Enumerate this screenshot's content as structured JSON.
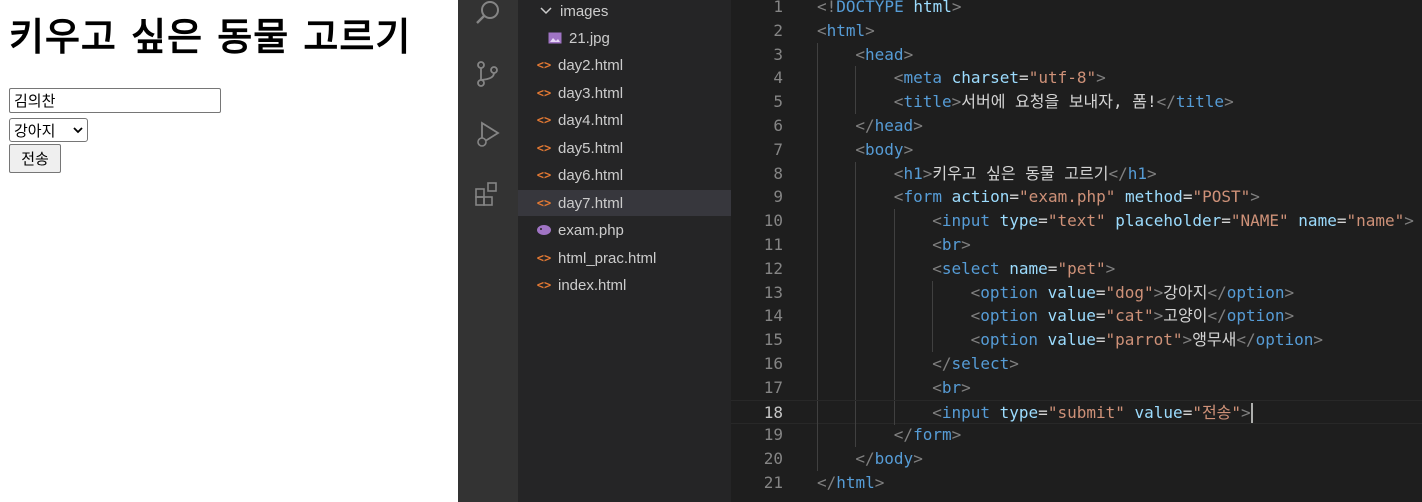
{
  "preview": {
    "heading": "키우고 싶은 동물 고르기",
    "name_value": "김의찬",
    "pet_selected": "강아지",
    "submit_label": "전송"
  },
  "activity_icons": [
    "search-icon",
    "source-control-icon",
    "run-debug-icon",
    "extensions-icon"
  ],
  "explorer": {
    "items": [
      {
        "label": "images",
        "kind": "folder"
      },
      {
        "label": "21.jpg",
        "kind": "image"
      },
      {
        "label": "day2.html",
        "kind": "html"
      },
      {
        "label": "day3.html",
        "kind": "html"
      },
      {
        "label": "day4.html",
        "kind": "html"
      },
      {
        "label": "day5.html",
        "kind": "html"
      },
      {
        "label": "day6.html",
        "kind": "html"
      },
      {
        "label": "day7.html",
        "kind": "html",
        "active": true
      },
      {
        "label": "exam.php",
        "kind": "php"
      },
      {
        "label": "html_prac.html",
        "kind": "html"
      },
      {
        "label": "index.html",
        "kind": "html"
      }
    ]
  },
  "editor": {
    "current_line": 18,
    "lines": [
      {
        "n": "1",
        "indent": 0,
        "tokens": [
          [
            "p",
            "<!"
          ],
          [
            "tag",
            "DOCTYPE"
          ],
          [
            "txt",
            " "
          ],
          [
            "attr",
            "html"
          ],
          [
            "p",
            ">"
          ]
        ]
      },
      {
        "n": "2",
        "indent": 0,
        "tokens": [
          [
            "p",
            "<"
          ],
          [
            "tag",
            "html"
          ],
          [
            "p",
            ">"
          ]
        ]
      },
      {
        "n": "3",
        "indent": 1,
        "tokens": [
          [
            "p",
            "<"
          ],
          [
            "tag",
            "head"
          ],
          [
            "p",
            ">"
          ]
        ]
      },
      {
        "n": "4",
        "indent": 2,
        "tokens": [
          [
            "p",
            "<"
          ],
          [
            "tag",
            "meta"
          ],
          [
            "txt",
            " "
          ],
          [
            "attr",
            "charset"
          ],
          [
            "eq",
            "="
          ],
          [
            "str",
            "\"utf-8\""
          ],
          [
            "p",
            ">"
          ]
        ]
      },
      {
        "n": "5",
        "indent": 2,
        "tokens": [
          [
            "p",
            "<"
          ],
          [
            "tag",
            "title"
          ],
          [
            "p",
            ">"
          ],
          [
            "txt",
            "서버에 요청을 보내자, 폼!"
          ],
          [
            "p",
            "</"
          ],
          [
            "tag",
            "title"
          ],
          [
            "p",
            ">"
          ]
        ]
      },
      {
        "n": "6",
        "indent": 1,
        "tokens": [
          [
            "p",
            "</"
          ],
          [
            "tag",
            "head"
          ],
          [
            "p",
            ">"
          ]
        ]
      },
      {
        "n": "7",
        "indent": 1,
        "tokens": [
          [
            "p",
            "<"
          ],
          [
            "tag",
            "body"
          ],
          [
            "p",
            ">"
          ]
        ]
      },
      {
        "n": "8",
        "indent": 2,
        "tokens": [
          [
            "p",
            "<"
          ],
          [
            "tag",
            "h1"
          ],
          [
            "p",
            ">"
          ],
          [
            "txt",
            "키우고 싶은 동물 고르기"
          ],
          [
            "p",
            "</"
          ],
          [
            "tag",
            "h1"
          ],
          [
            "p",
            ">"
          ]
        ]
      },
      {
        "n": "9",
        "indent": 2,
        "tokens": [
          [
            "p",
            "<"
          ],
          [
            "tag",
            "form"
          ],
          [
            "txt",
            " "
          ],
          [
            "attr",
            "action"
          ],
          [
            "eq",
            "="
          ],
          [
            "str",
            "\"exam.php\""
          ],
          [
            "txt",
            " "
          ],
          [
            "attr",
            "method"
          ],
          [
            "eq",
            "="
          ],
          [
            "str",
            "\"POST\""
          ],
          [
            "p",
            ">"
          ]
        ]
      },
      {
        "n": "10",
        "indent": 3,
        "tokens": [
          [
            "p",
            "<"
          ],
          [
            "tag",
            "input"
          ],
          [
            "txt",
            " "
          ],
          [
            "attr",
            "type"
          ],
          [
            "eq",
            "="
          ],
          [
            "str",
            "\"text\""
          ],
          [
            "txt",
            " "
          ],
          [
            "attr",
            "placeholder"
          ],
          [
            "eq",
            "="
          ],
          [
            "str",
            "\"NAME\""
          ],
          [
            "txt",
            " "
          ],
          [
            "attr",
            "name"
          ],
          [
            "eq",
            "="
          ],
          [
            "str",
            "\"name\""
          ],
          [
            "p",
            ">"
          ]
        ]
      },
      {
        "n": "11",
        "indent": 3,
        "tokens": [
          [
            "p",
            "<"
          ],
          [
            "tag",
            "br"
          ],
          [
            "p",
            ">"
          ]
        ]
      },
      {
        "n": "12",
        "indent": 3,
        "tokens": [
          [
            "p",
            "<"
          ],
          [
            "tag",
            "select"
          ],
          [
            "txt",
            " "
          ],
          [
            "attr",
            "name"
          ],
          [
            "eq",
            "="
          ],
          [
            "str",
            "\"pet\""
          ],
          [
            "p",
            ">"
          ]
        ]
      },
      {
        "n": "13",
        "indent": 4,
        "tokens": [
          [
            "p",
            "<"
          ],
          [
            "tag",
            "option"
          ],
          [
            "txt",
            " "
          ],
          [
            "attr",
            "value"
          ],
          [
            "eq",
            "="
          ],
          [
            "str",
            "\"dog\""
          ],
          [
            "p",
            ">"
          ],
          [
            "txt",
            "강아지"
          ],
          [
            "p",
            "</"
          ],
          [
            "tag",
            "option"
          ],
          [
            "p",
            ">"
          ]
        ]
      },
      {
        "n": "14",
        "indent": 4,
        "tokens": [
          [
            "p",
            "<"
          ],
          [
            "tag",
            "option"
          ],
          [
            "txt",
            " "
          ],
          [
            "attr",
            "value"
          ],
          [
            "eq",
            "="
          ],
          [
            "str",
            "\"cat\""
          ],
          [
            "p",
            ">"
          ],
          [
            "txt",
            "고양이"
          ],
          [
            "p",
            "</"
          ],
          [
            "tag",
            "option"
          ],
          [
            "p",
            ">"
          ]
        ]
      },
      {
        "n": "15",
        "indent": 4,
        "tokens": [
          [
            "p",
            "<"
          ],
          [
            "tag",
            "option"
          ],
          [
            "txt",
            " "
          ],
          [
            "attr",
            "value"
          ],
          [
            "eq",
            "="
          ],
          [
            "str",
            "\"parrot\""
          ],
          [
            "p",
            ">"
          ],
          [
            "txt",
            "앵무새"
          ],
          [
            "p",
            "</"
          ],
          [
            "tag",
            "option"
          ],
          [
            "p",
            ">"
          ]
        ]
      },
      {
        "n": "16",
        "indent": 3,
        "tokens": [
          [
            "p",
            "</"
          ],
          [
            "tag",
            "select"
          ],
          [
            "p",
            ">"
          ]
        ]
      },
      {
        "n": "17",
        "indent": 3,
        "tokens": [
          [
            "p",
            "<"
          ],
          [
            "tag",
            "br"
          ],
          [
            "p",
            ">"
          ]
        ]
      },
      {
        "n": "18",
        "indent": 3,
        "tokens": [
          [
            "p",
            "<"
          ],
          [
            "tag",
            "input"
          ],
          [
            "txt",
            " "
          ],
          [
            "attr",
            "type"
          ],
          [
            "eq",
            "="
          ],
          [
            "str",
            "\"submit\""
          ],
          [
            "txt",
            " "
          ],
          [
            "attr",
            "value"
          ],
          [
            "eq",
            "="
          ],
          [
            "str",
            "\"전송\""
          ],
          [
            "p",
            ">"
          ]
        ]
      },
      {
        "n": "19",
        "indent": 2,
        "tokens": [
          [
            "p",
            "</"
          ],
          [
            "tag",
            "form"
          ],
          [
            "p",
            ">"
          ]
        ]
      },
      {
        "n": "20",
        "indent": 1,
        "tokens": [
          [
            "p",
            "</"
          ],
          [
            "tag",
            "body"
          ],
          [
            "p",
            ">"
          ]
        ]
      },
      {
        "n": "21",
        "indent": 0,
        "tokens": [
          [
            "p",
            "</"
          ],
          [
            "tag",
            "html"
          ],
          [
            "p",
            ">"
          ]
        ]
      }
    ]
  }
}
